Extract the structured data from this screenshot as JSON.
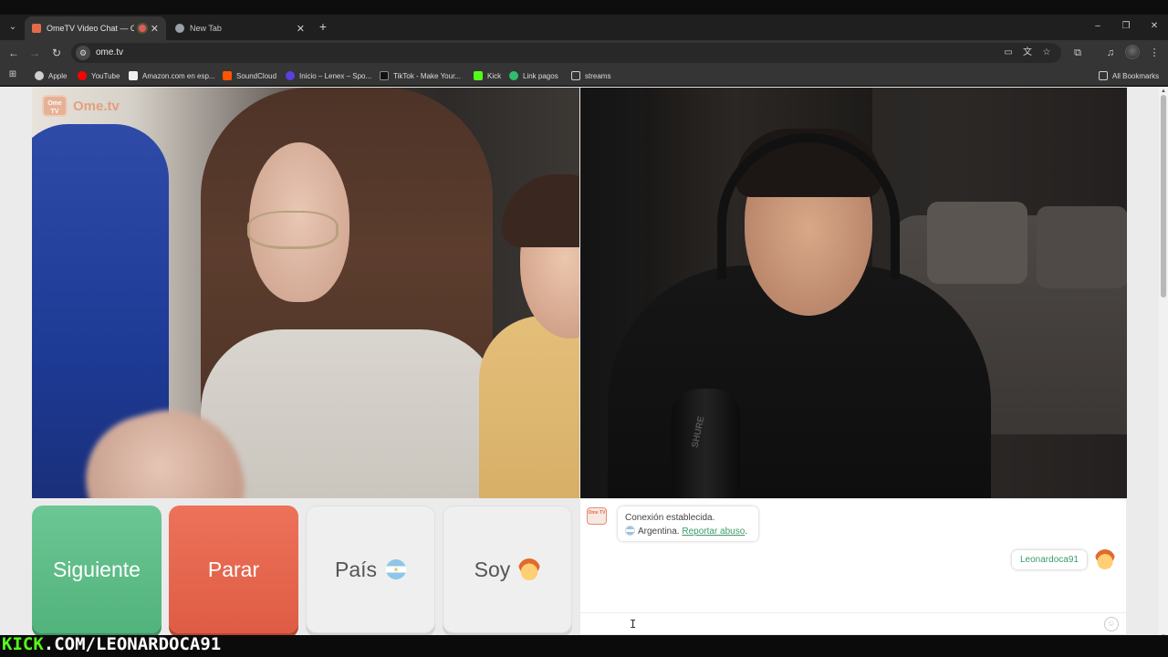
{
  "browser": {
    "tabs": [
      {
        "title": "OmeTV Video Chat — Omegle",
        "active": true
      },
      {
        "title": "New Tab",
        "active": false
      }
    ],
    "new_tab_label": "+",
    "url": "ome.tv",
    "window_controls": {
      "minimize": "–",
      "restore": "❐",
      "close": "✕"
    },
    "bookmarks": [
      {
        "label": "Apple",
        "icon": "apple-icon",
        "color": "#cfcfcf"
      },
      {
        "label": "YouTube",
        "icon": "youtube-icon",
        "color": "#ff0000"
      },
      {
        "label": "Amazon.com en esp...",
        "icon": "amazon-icon",
        "color": "#f0f0f0"
      },
      {
        "label": "SoundCloud",
        "icon": "soundcloud-icon",
        "color": "#ff5500"
      },
      {
        "label": "Inicio – Lenex – Spo...",
        "icon": "lenex-icon",
        "color": "#5b3fe0"
      },
      {
        "label": "TikTok - Make Your...",
        "icon": "tiktok-icon",
        "color": "#111111"
      },
      {
        "label": "Kick",
        "icon": "kick-icon",
        "color": "#53fc18"
      },
      {
        "label": "Link pagos",
        "icon": "link-icon",
        "color": "#2dbf6a"
      },
      {
        "label": "streams",
        "icon": "folder-icon",
        "color": "#cfcfcf"
      }
    ],
    "all_bookmarks": "All Bookmarks"
  },
  "ometv": {
    "logo_badge": "Ome TV",
    "logo_text": "Ome.tv",
    "mic_brand": "SHURE",
    "buttons": {
      "next": "Siguiente",
      "stop": "Parar",
      "country": "País",
      "me": "Soy"
    },
    "chat": {
      "system_line1": "Conexión establecida.",
      "country": "Argentina.",
      "report": "Reportar abuso",
      "report_suffix": ".",
      "my_name": "Leonardoca91"
    }
  },
  "overlay": {
    "kick_prefix": "KICK",
    "kick_suffix": ".COM/LEONARDOCA91"
  },
  "colors": {
    "next_button": "#5bbd85",
    "stop_button": "#e3634b",
    "accent_green": "#3c9a6a",
    "kick_green": "#53fc18"
  }
}
